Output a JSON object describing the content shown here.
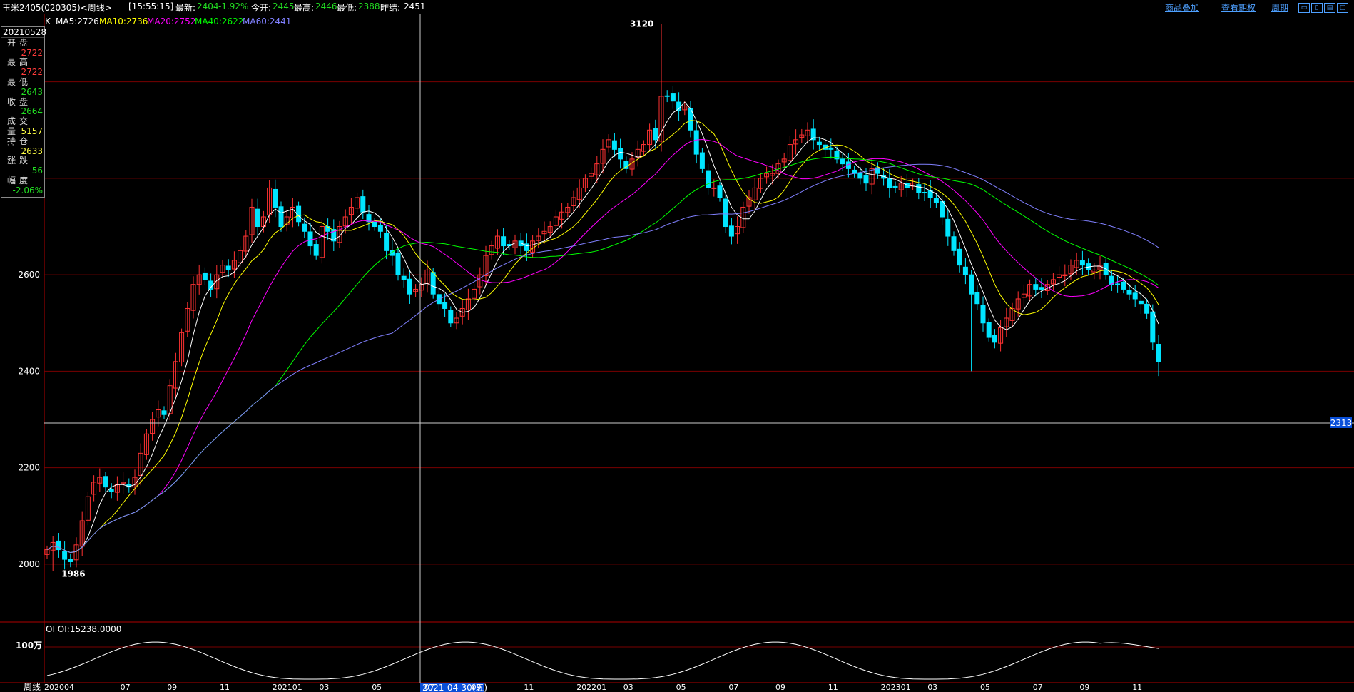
{
  "header": {
    "symbol": "玉米2405(020305)<周线>",
    "time": "[15:55:15]",
    "latest_label": "最新:",
    "latest": "2404",
    "change": "-1.92%",
    "open_label": "今开:",
    "open": "2445",
    "high_label": "最高:",
    "high": "2446",
    "low_label": "最低:",
    "low": "2388",
    "prev_label": "昨结:",
    "prev": "2451",
    "links": [
      "商品叠加",
      "查看期权",
      "周期"
    ]
  },
  "ma_legend": {
    "k": "K",
    "ma5": "MA5:2726",
    "ma10": "MA10:2736",
    "ma20": "MA20:2752",
    "ma40": "MA40:2622",
    "ma60": "MA60:2441"
  },
  "info_panel": {
    "date": "20210528",
    "rows": [
      {
        "label": "开盘",
        "value": "2722",
        "color": "#ff3b3b"
      },
      {
        "label": "最高",
        "value": "2722",
        "color": "#ff3b3b"
      },
      {
        "label": "最低",
        "value": "2643",
        "color": "#22dd22"
      },
      {
        "label": "收盘",
        "value": "2664",
        "color": "#22dd22"
      },
      {
        "label": "成交量",
        "value": "5157",
        "color": "#ffff44"
      },
      {
        "label": "持仓",
        "value": "2633",
        "color": "#ffff44"
      },
      {
        "label": "涨跌",
        "value": "-56",
        "color": "#22dd22"
      },
      {
        "label": "幅度",
        "value": "-2.06%",
        "color": "#22dd22"
      }
    ]
  },
  "oi_panel": {
    "label": "OI  OI:15238.0000",
    "axis_label": "100万"
  },
  "crosshair": {
    "price": "2313",
    "date": "2021-04-30(五)"
  },
  "colors": {
    "up": "#ff3232",
    "down": "#00e5ff",
    "ma5": "#ffffff",
    "ma10": "#ffff00",
    "ma20": "#ff00ff",
    "ma40": "#00ff00",
    "ma60": "#8080ff",
    "grid": "#7a0000",
    "frame": "#b00000",
    "badge": "#0a4fd8"
  },
  "chart_data": {
    "type": "candlestick",
    "period_label": "周线",
    "x_ticks": [
      "202004",
      "07",
      "09",
      "11",
      "202101",
      "03",
      "05",
      "07",
      "09",
      "11",
      "202201",
      "03",
      "05",
      "07",
      "09",
      "11",
      "202301",
      "03",
      "05",
      "07",
      "09",
      "11"
    ],
    "x_tick_index": [
      0,
      13,
      21,
      30,
      39,
      47,
      56,
      65,
      73,
      82,
      91,
      99,
      108,
      117,
      125,
      134,
      143,
      151,
      160,
      169,
      177,
      186
    ],
    "y_ticks": [
      2000,
      2200,
      2400,
      2600
    ],
    "ylim": [
      1880,
      3140
    ],
    "annotations": [
      {
        "text": "3120",
        "index": 105,
        "price": 3120
      },
      {
        "text": "1986",
        "index": 1,
        "price": 1986
      }
    ],
    "n_bars": 191,
    "close": [
      2030,
      2045,
      2030,
      2010,
      2005,
      2040,
      2090,
      2140,
      2170,
      2180,
      2160,
      2150,
      2165,
      2170,
      2160,
      2180,
      2230,
      2270,
      2300,
      2320,
      2310,
      2370,
      2420,
      2480,
      2530,
      2580,
      2600,
      2590,
      2570,
      2600,
      2620,
      2610,
      2630,
      2650,
      2680,
      2740,
      2700,
      2720,
      2780,
      2740,
      2700,
      2720,
      2740,
      2710,
      2690,
      2660,
      2640,
      2700,
      2690,
      2670,
      2700,
      2720,
      2740,
      2760,
      2730,
      2710,
      2700,
      2690,
      2650,
      2640,
      2600,
      2590,
      2560,
      2570,
      2580,
      2610,
      2560,
      2540,
      2530,
      2500,
      2510,
      2530,
      2550,
      2570,
      2600,
      2640,
      2660,
      2680,
      2660,
      2660,
      2670,
      2660,
      2650,
      2670,
      2680,
      2690,
      2700,
      2720,
      2730,
      2740,
      2760,
      2780,
      2800,
      2810,
      2830,
      2860,
      2880,
      2860,
      2840,
      2820,
      2840,
      2860,
      2870,
      2900,
      2880,
      2970,
      2970,
      2960,
      2940,
      2950,
      2900,
      2850,
      2820,
      2780,
      2780,
      2760,
      2700,
      2680,
      2700,
      2740,
      2760,
      2780,
      2800,
      2810,
      2810,
      2830,
      2840,
      2870,
      2880,
      2890,
      2900,
      2880,
      2870,
      2860,
      2860,
      2840,
      2830,
      2820,
      2810,
      2800,
      2790,
      2820,
      2810,
      2800,
      2780,
      2780,
      2790,
      2780,
      2790,
      2770,
      2770,
      2760,
      2750,
      2720,
      2680,
      2650,
      2620,
      2600,
      2560,
      2540,
      2500,
      2470,
      2460,
      2490,
      2510,
      2530,
      2550,
      2560,
      2580,
      2570,
      2570,
      2580,
      2590,
      2600,
      2600,
      2620,
      2630,
      2620,
      2610,
      2610,
      2620,
      2600,
      2580,
      2580,
      2570,
      2560,
      2550,
      2540,
      2520,
      2460,
      2420
    ],
    "ma5_last": 2726,
    "ma10_last": 2736,
    "ma20_last": 2752,
    "ma40_last": 2622,
    "ma60_last": 2441,
    "oi_note": "open interest curve"
  }
}
